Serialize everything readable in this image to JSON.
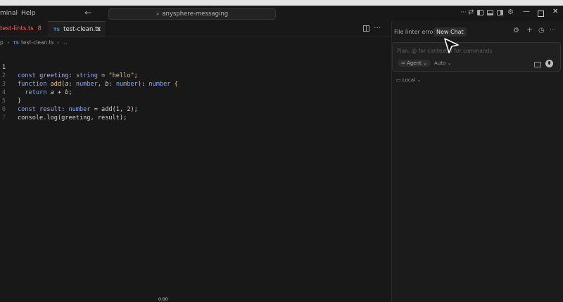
{
  "menu": {
    "terminal": "minal",
    "help": "Help"
  },
  "search": {
    "label": "anysphere-messaging"
  },
  "tabs": [
    {
      "label": "test-lints.ts",
      "badge": "8"
    },
    {
      "label": "test-clean.ts",
      "close": "×"
    }
  ],
  "breadcrumb": {
    "prefix": "p",
    "sep": "›",
    "file": "test-clean.ts",
    "tail": "…"
  },
  "ts_badge": "TS",
  "code": {
    "line_numbers": [
      "1",
      "2",
      "3",
      "4",
      "5",
      "6",
      "7"
    ],
    "l1": {
      "kw": "const",
      "var": "greeting",
      "colon": ":",
      "type": "string",
      "eq": " = ",
      "str": "\"hello\"",
      "semi": ";"
    },
    "l2": {
      "kw": "function",
      "fn": "add",
      "p1": "(",
      "a": "a",
      "c1": ": ",
      "t1": "number",
      "comma": ", ",
      "b": "b",
      "c2": ": ",
      "t2": "number",
      "p2": "): ",
      "ret": "number",
      "brace": " {"
    },
    "l3": {
      "kw": "return",
      "a": "a",
      "plus": " + ",
      "b": "b",
      "semi": ";"
    },
    "l4": {
      "brace": "}"
    },
    "l5": {
      "kw": "const",
      "var": "result",
      "colon": ": ",
      "type": "number",
      "eq": " = ",
      "fn": "add",
      "p1": "(",
      "n1": "1",
      "comma": ", ",
      "n2": "2",
      "p2": ");"
    },
    "l6": {
      "obj": "console",
      "dot": ".",
      "fn": "log",
      "args": "(greeting, result);"
    }
  },
  "panel": {
    "tab_linter": "File linter errors",
    "tab_new_chat": "New Chat",
    "input_placeholder": "Plan, @ for context, / for commands",
    "agent_label": "Agent",
    "auto_label": "Auto",
    "local_label": "Local"
  },
  "icons": {
    "back": "←",
    "search": "⌕",
    "chevron_down": "⌄",
    "gear": "⚙",
    "plus": "+",
    "history": "◷",
    "more": "···",
    "minimize": "—",
    "close": "✕",
    "swap": "⇄",
    "infinity": "∞",
    "laptop": "▭"
  },
  "timestamp": "0:00"
}
